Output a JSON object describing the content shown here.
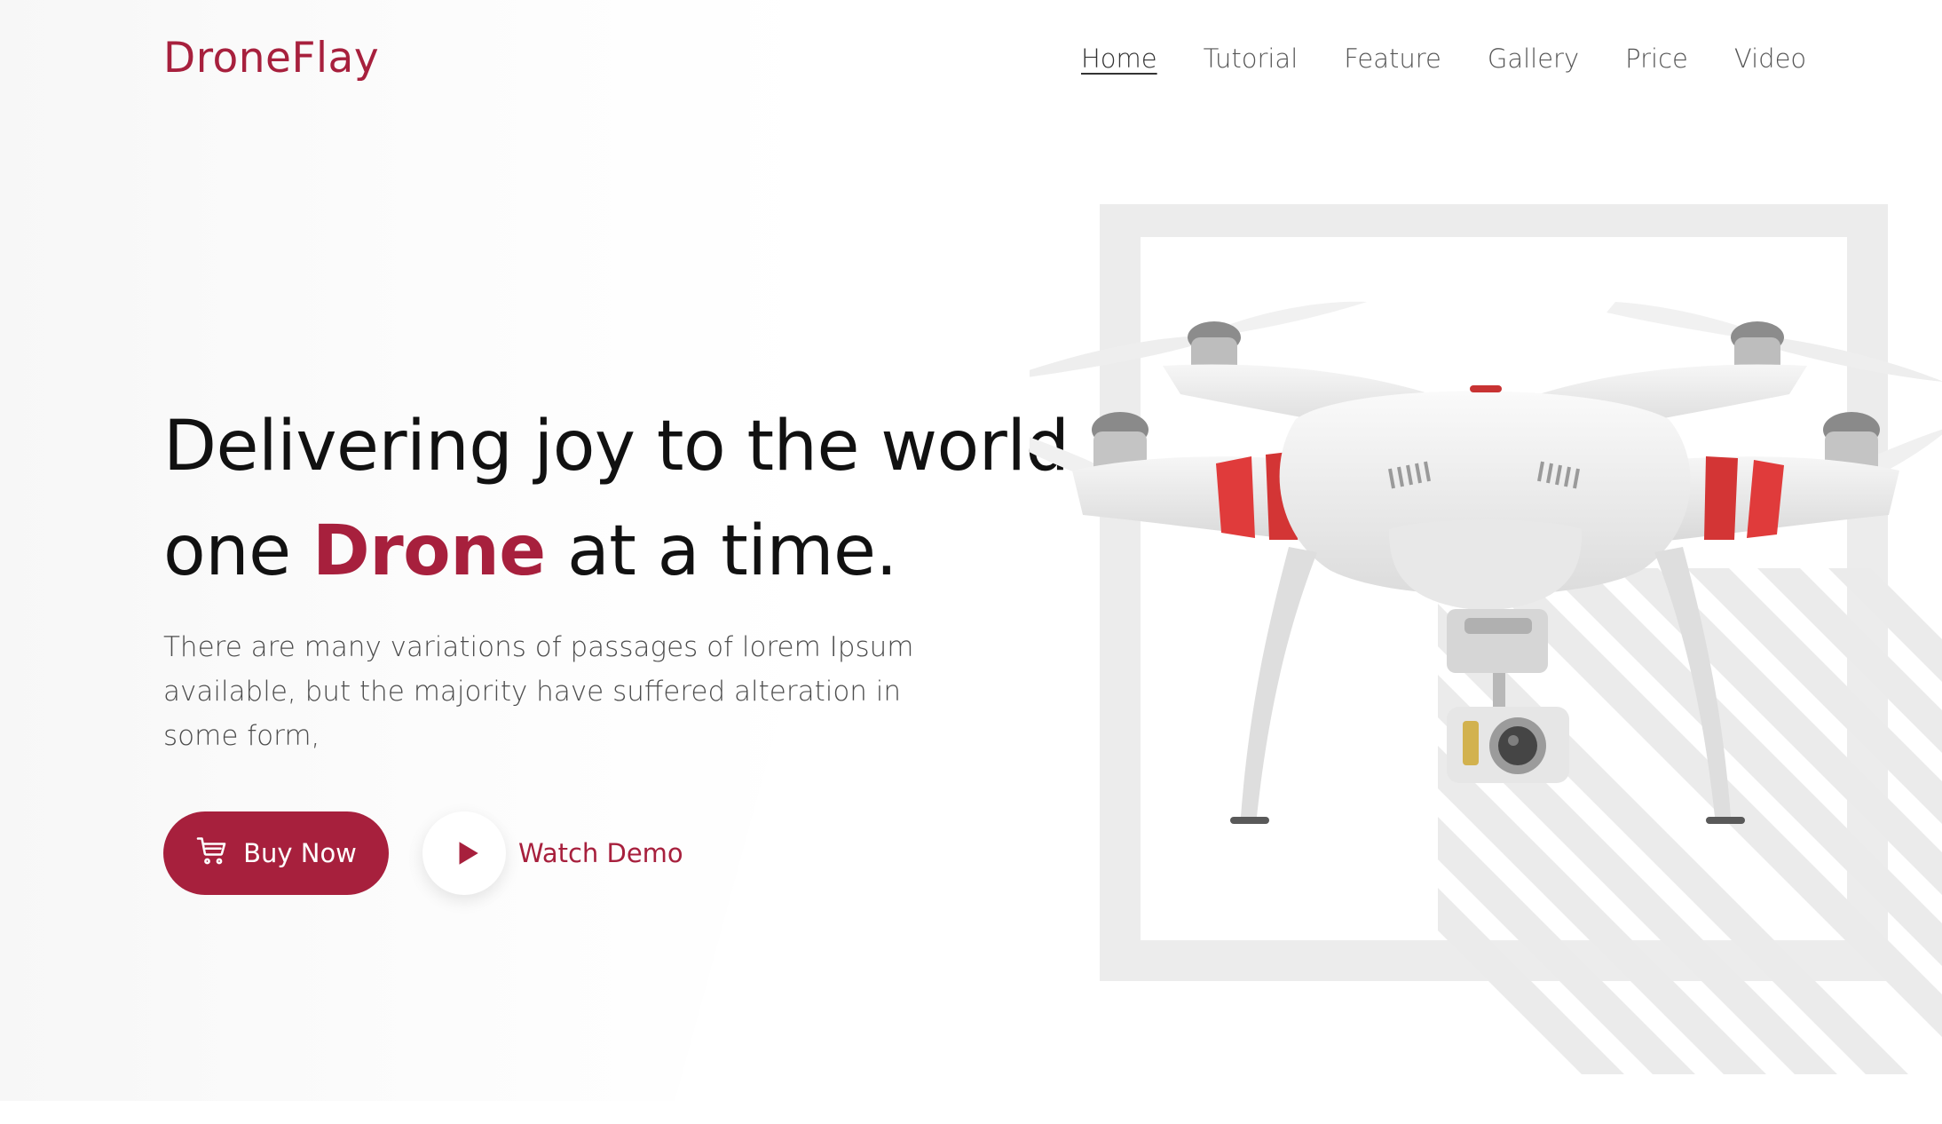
{
  "brand": {
    "name": "DroneFlay",
    "accent": "#a7203d"
  },
  "nav": {
    "items": [
      {
        "label": "Home",
        "active": true
      },
      {
        "label": "Tutorial",
        "active": false
      },
      {
        "label": "Feature",
        "active": false
      },
      {
        "label": "Gallery",
        "active": false
      },
      {
        "label": "Price",
        "active": false
      },
      {
        "label": "Video",
        "active": false
      }
    ]
  },
  "hero": {
    "title_line1": "Delivering joy to the world,",
    "title_line2_prefix": "one ",
    "title_highlight": "Drone",
    "title_line2_suffix": " at a time.",
    "description": "There are many variations of passages of lorem Ipsum available, but the majority have suffered alteration in some form,",
    "buy_label": "Buy Now",
    "demo_label": "Watch Demo"
  },
  "icons": {
    "buy": "shopping-cart-icon",
    "demo": "play-icon"
  }
}
